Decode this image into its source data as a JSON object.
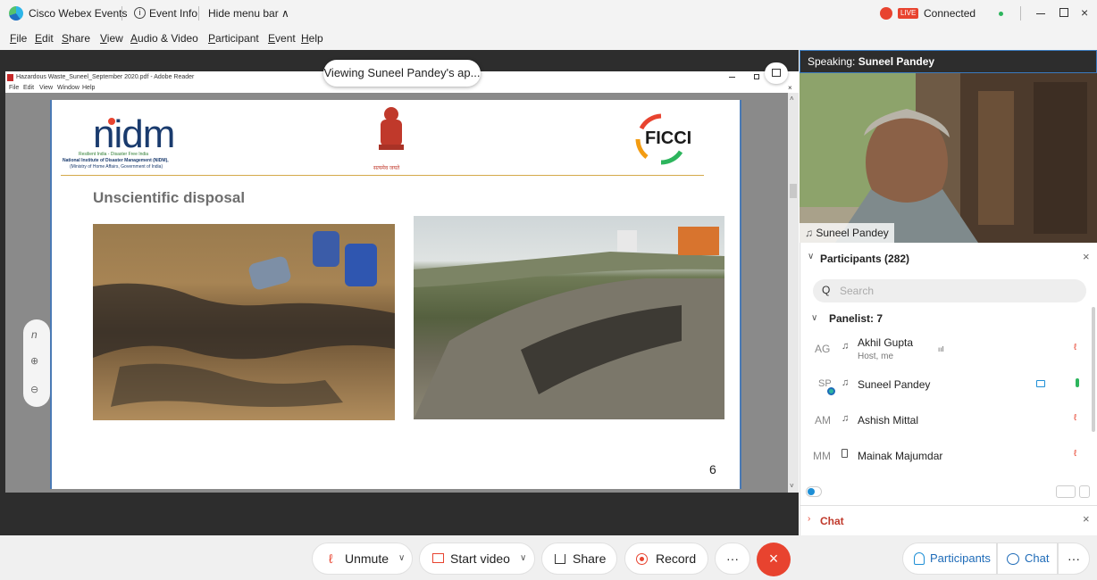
{
  "titlebar": {
    "app_name": "Cisco Webex Events",
    "event_info": "Event Info",
    "hide_menu": "Hide menu bar ∧",
    "live_badge": "LIVE",
    "connection_status": "Connected"
  },
  "menu": [
    "File",
    "Edit",
    "Share",
    "View",
    "Audio & Video",
    "Participant",
    "Event",
    "Help"
  ],
  "shared": {
    "viewing_label": "Viewing Suneel Pandey's ap...",
    "adobe_title": "Hazardous Waste_Suneel_September 2020.pdf - Adobe Reader",
    "adobe_menu": [
      "File",
      "Edit",
      "View",
      "Window",
      "Help"
    ]
  },
  "slide": {
    "nidm_logo": "nidm",
    "nidm_tagline": "Resilient India - Disaster Free India",
    "nidm_name": "National Institute of Disaster Management (NIDM),",
    "nidm_ministry": "(Ministry of Home Affairs, Government of India)",
    "emblem_motto": "सत्यमेव जयते",
    "ficci_logo": "FICCI",
    "heading": "Unscientific disposal",
    "page_number": "6"
  },
  "speaking": {
    "prefix": "Speaking:",
    "name": "Suneel Pandey",
    "video_label": "Suneel Pandey"
  },
  "participants_panel": {
    "title": "Participants (282)",
    "search_placeholder": "Search",
    "group_label": "Panelist: 7",
    "items": [
      {
        "initials": "AG",
        "name": "Akhil Gupta",
        "sub": "Host, me"
      },
      {
        "initials": "SP",
        "name": "Suneel Pandey",
        "sub": ""
      },
      {
        "initials": "AM",
        "name": "Ashish Mittal",
        "sub": ""
      },
      {
        "initials": "MM",
        "name": "Mainak Majumdar",
        "sub": ""
      }
    ],
    "chat_label": "Chat"
  },
  "toolbar": {
    "unmute": "Unmute",
    "start_video": "Start video",
    "share": "Share",
    "record": "Record",
    "more": "···",
    "participants": "Participants",
    "chat": "Chat"
  },
  "colors": {
    "accent_blue": "#3b7bbf",
    "live_red": "#e8432f",
    "end_red": "#e8432f",
    "connected_green": "#2db55d",
    "mic_muted": "#e8432f"
  }
}
